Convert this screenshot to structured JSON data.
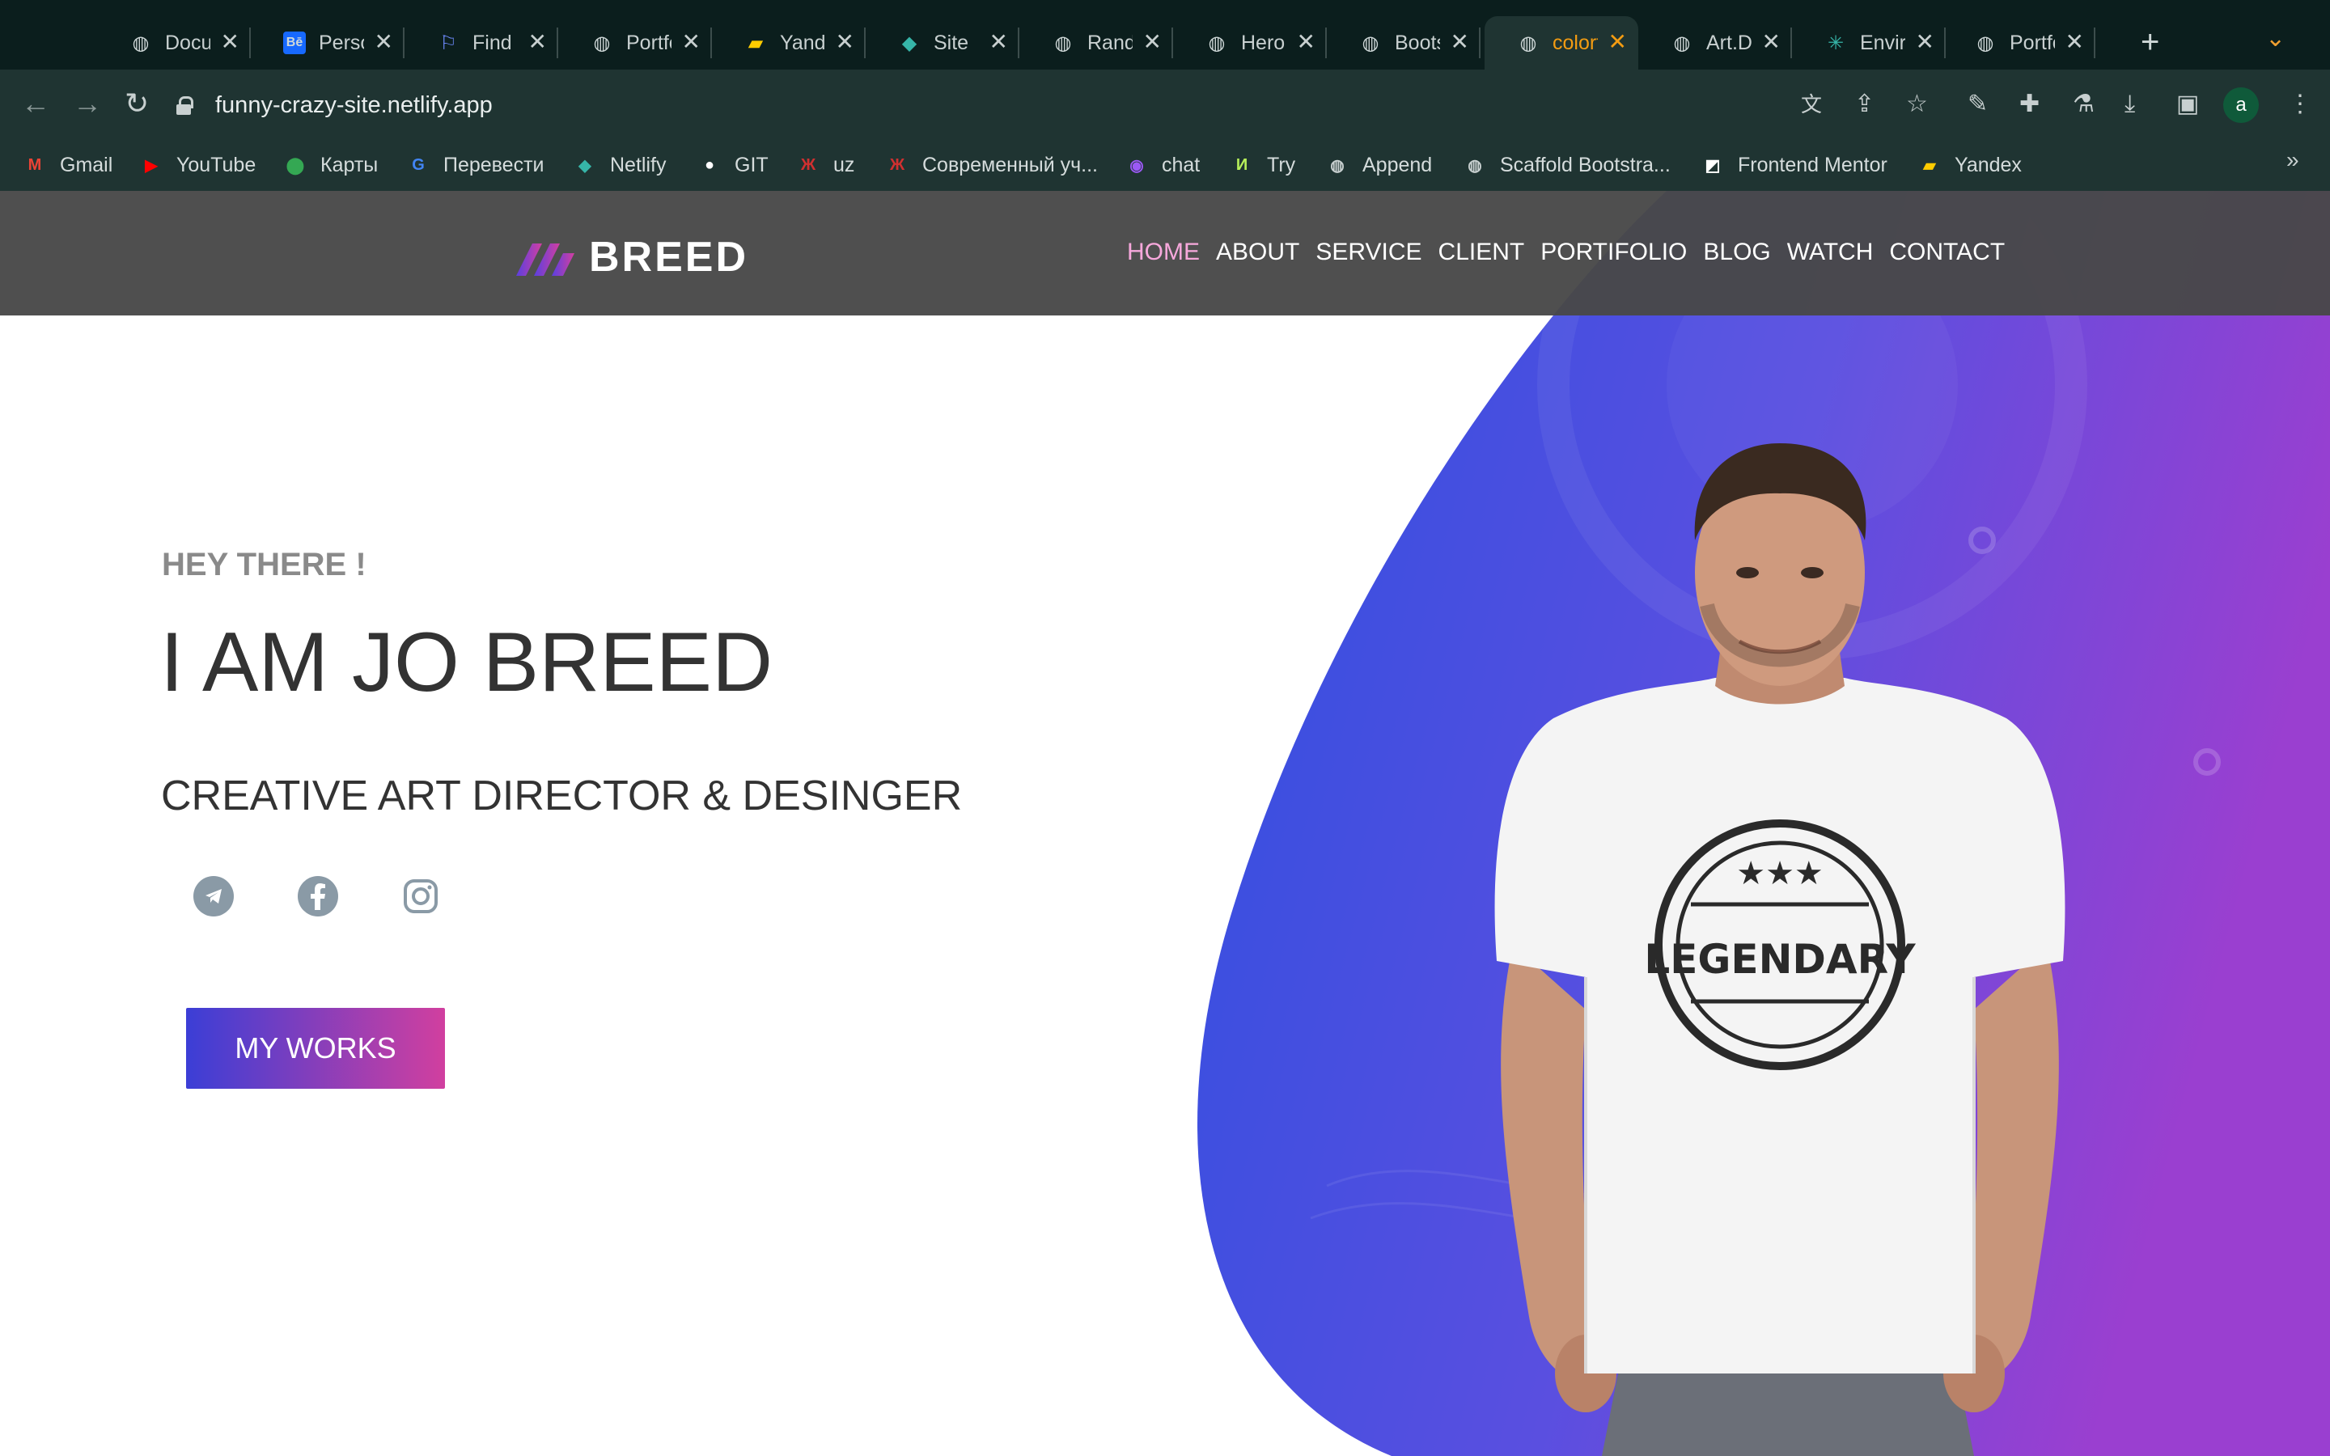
{
  "browser": {
    "tabs": [
      {
        "title": "Documentation",
        "icon": "globe-icon"
      },
      {
        "title": "Personal",
        "icon": "behance-icon"
      },
      {
        "title": "Find",
        "icon": "flag-icon"
      },
      {
        "title": "Portfolio",
        "icon": "globe-icon"
      },
      {
        "title": "Yandex",
        "icon": "yandex-icon"
      },
      {
        "title": "Site",
        "icon": "netlify-icon"
      },
      {
        "title": "Random",
        "icon": "globe-icon"
      },
      {
        "title": "Hero",
        "icon": "globe-icon"
      },
      {
        "title": "Bootstrap",
        "icon": "globe-icon"
      },
      {
        "title": "colorful",
        "icon": "globe-icon",
        "active": true
      },
      {
        "title": "Art.Director",
        "icon": "globe-icon"
      },
      {
        "title": "Environment",
        "icon": "sparkle-icon"
      },
      {
        "title": "Portfolio",
        "icon": "globe-icon"
      }
    ],
    "url": "funny-crazy-site.netlify.app",
    "bookmarks": [
      {
        "label": "Gmail",
        "icon": "gmail-icon",
        "color": "#ea4335"
      },
      {
        "label": "YouTube",
        "icon": "youtube-icon",
        "color": "#ff0000"
      },
      {
        "label": "Карты",
        "icon": "maps-icon",
        "color": "#34a853"
      },
      {
        "label": "Перевести",
        "icon": "translate-icon",
        "color": "#4285f4"
      },
      {
        "label": "Netlify",
        "icon": "netlify-icon",
        "color": "#36b5a8"
      },
      {
        "label": "GIT",
        "icon": "github-icon",
        "color": "#ffffff"
      },
      {
        "label": "uz",
        "icon": "tower-icon",
        "color": "#d03030"
      },
      {
        "label": "Современный уч...",
        "icon": "tower-icon",
        "color": "#d03030"
      },
      {
        "label": "chat",
        "icon": "chat-icon",
        "color": "#9b59f5"
      },
      {
        "label": "Try",
        "icon": "try-icon",
        "color": "#b7f05a"
      },
      {
        "label": "Append",
        "icon": "globe-icon",
        "color": "#c8d0d0"
      },
      {
        "label": "Scaffold Bootstra...",
        "icon": "globe-icon",
        "color": "#c8d0d0"
      },
      {
        "label": "Frontend Mentor",
        "icon": "frontend-mentor-icon",
        "color": "#ffffff"
      },
      {
        "label": "Yandex",
        "icon": "yandex-icon",
        "color": "#ffcc00"
      }
    ],
    "bookmarks_more": "»"
  },
  "site": {
    "logo_text": "BREED",
    "nav": [
      "HOME",
      "ABOUT",
      "SERVICE",
      "CLIENT",
      "PORTIFOLIO",
      "BLOG",
      "WATCH",
      "CONTACT"
    ],
    "nav_active_color": "#f7a8dc",
    "greeting": "HEY THERE !",
    "heading": "I AM JO BREED",
    "role": "CREATIVE ART DIRECTOR & DESINGER",
    "social": [
      {
        "name": "telegram-icon"
      },
      {
        "name": "facebook-icon"
      },
      {
        "name": "instagram-icon"
      }
    ],
    "cta": "MY WORKS",
    "shirt_text": "LEGENDARY",
    "colors": {
      "blob_start": "#2f4fe0",
      "blob_end": "#9a3fd0",
      "button_start": "#3b3ed6",
      "button_end": "#d13f9f"
    }
  }
}
